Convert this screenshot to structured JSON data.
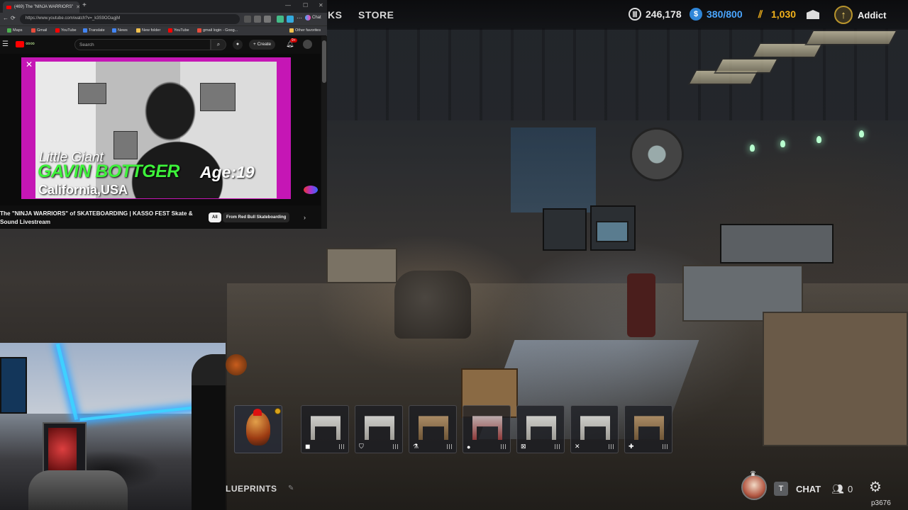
{
  "game_hud": {
    "tabs": [
      "KS",
      "STORE"
    ],
    "currencies": [
      {
        "icon": "coins-icon",
        "value": "246,178",
        "color": "#e8e8e8"
      },
      {
        "icon": "blue-token-icon",
        "value": "380/800",
        "color": "#4aa6ff"
      },
      {
        "icon": "gold-bars-icon",
        "value": "1,030",
        "color": "#f2b21b"
      }
    ],
    "mail_icon": "mail-icon",
    "rank_label": "Addict"
  },
  "browser": {
    "tab_title": "(469) The \"NINJA WARRIORS\"",
    "address": "https://www.youtube.com/watch?v=_k3S9OOagjM",
    "chat_label": "Chat",
    "bookmarks": [
      {
        "label": "Maps",
        "color": "#4caf50"
      },
      {
        "label": "Gmail",
        "color": "#e74c3c"
      },
      {
        "label": "YouTube",
        "color": "#ff0000"
      },
      {
        "label": "Translate",
        "color": "#4285f4"
      },
      {
        "label": "News",
        "color": "#4285f4"
      },
      {
        "label": "New folder",
        "color": "#f2c14e"
      },
      {
        "label": "YouTube",
        "color": "#ff0000"
      },
      {
        "label": "gmail login - Goog...",
        "color": "#e74c3c"
      },
      {
        "label": "Other favorites",
        "color": "#f2c14e"
      }
    ]
  },
  "youtube": {
    "search_placeholder": "Search",
    "create_label": "Create",
    "notification_badge": "9+",
    "overlay": {
      "subtitle": "Little Giant",
      "name": "GAVIN BOTTGER",
      "age": "Age:19",
      "place": "California,USA"
    },
    "video_title": "The \"NINJA WARRIORS\" of SKATEBOARDING | KASSO FEST Skate & Sound Livestream",
    "chips": [
      "All",
      "From Red Bull Skateboarding"
    ]
  },
  "hotbar": {
    "slots": [
      {
        "name": "rooster",
        "category_icon": ""
      },
      {
        "name": "workbench-1",
        "category_icon": "◼"
      },
      {
        "name": "workbench-2",
        "category_icon": "⛉"
      },
      {
        "name": "workbench-3",
        "category_icon": "⚗"
      },
      {
        "name": "workbench-4",
        "category_icon": "●"
      },
      {
        "name": "workbench-5",
        "category_icon": "⊠"
      },
      {
        "name": "workbench-6",
        "category_icon": "✕"
      },
      {
        "name": "workbench-7",
        "category_icon": "✚"
      }
    ]
  },
  "bottom_hud": {
    "blueprints_label": "LUEPRINTS",
    "chat_key": "T",
    "chat_label": "CHAT",
    "friends_count": "0",
    "player_id": "p3676"
  }
}
